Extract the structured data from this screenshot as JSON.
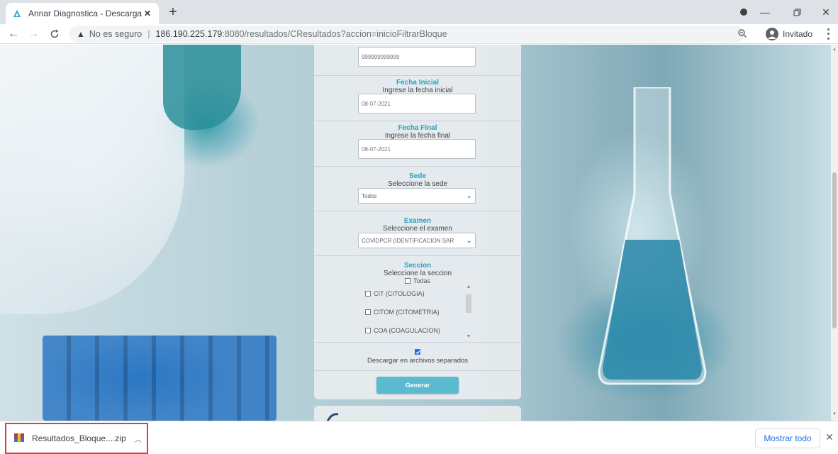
{
  "browser": {
    "tab_title": "Annar Diagnostica - Descarga W",
    "omnibox": {
      "security_label": "No es seguro",
      "url_host": "186.190.225.179",
      "url_rest": ":8080/resultados/CResultados?accion=inicioFiltrarBloque"
    },
    "profile_label": "Invitado"
  },
  "form": {
    "top_value": "999999999999",
    "fecha_inicial": {
      "label": "Fecha Inicial",
      "hint": "Ingrese la fecha inicial",
      "value": "08-07-2021"
    },
    "fecha_final": {
      "label": "Fecha Final",
      "hint": "Ingrese la fecha final",
      "value": "08-07-2021"
    },
    "sede": {
      "label": "Sede",
      "hint": "Seleccione la sede",
      "selected": "Todos"
    },
    "examen": {
      "label": "Examen",
      "hint": "Seleccione el examen",
      "selected": "COVIDPCR (IDENTIFICACION SAR"
    },
    "seccion": {
      "label": "Seccion",
      "hint": "Seleccione la seccion",
      "all_label": "Todas",
      "items": [
        "CIT (CITOLOGIA)",
        "CITOM (CITOMETRIA)",
        "COA (COAGULACION)"
      ]
    },
    "separate_files_label": "Descargar en archivos separados",
    "separate_files_checked": true,
    "generate_label": "Generar"
  },
  "download_shelf": {
    "file_name": "Resultados_Bloque....zip",
    "show_all_label": "Mostrar todo"
  },
  "colors": {
    "accent_label": "#2aa0c0",
    "button": "#5bbad0",
    "highlight_border": "#e53935"
  }
}
